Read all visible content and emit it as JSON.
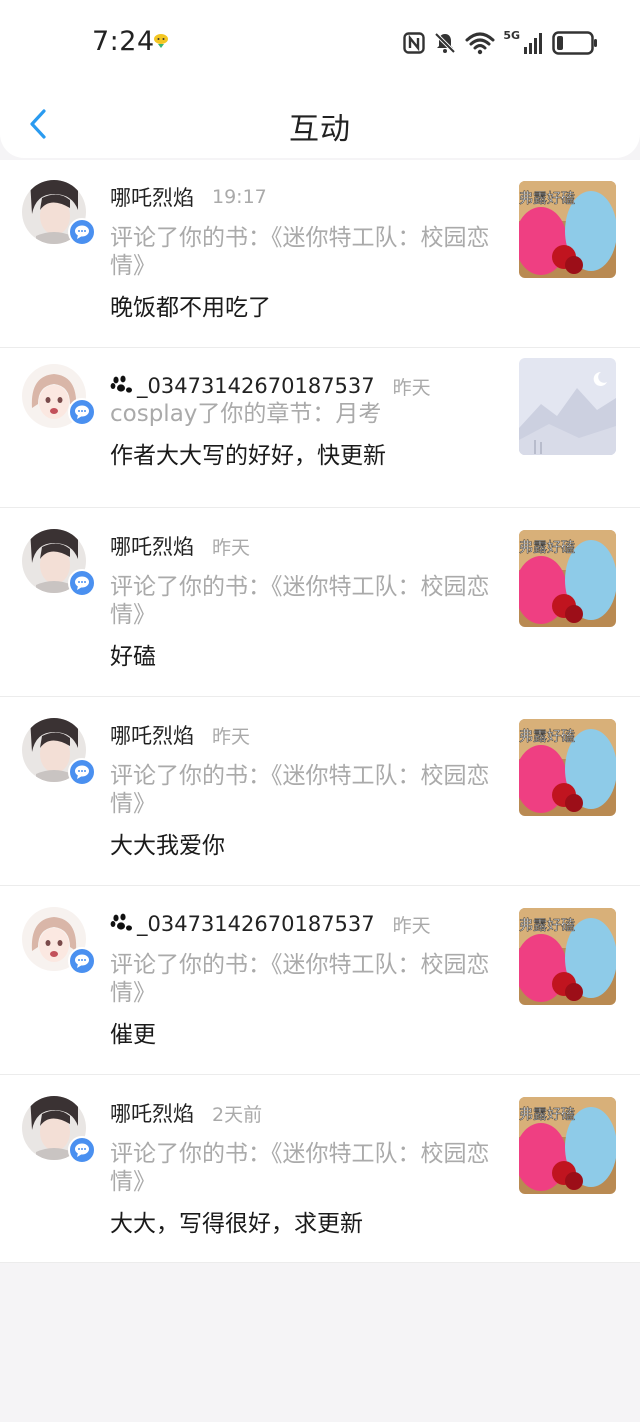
{
  "status": {
    "time": "7:24",
    "network_label": "5G"
  },
  "header": {
    "title": "互动"
  },
  "items": [
    {
      "user": "哪吒烈焰",
      "time": "19:17",
      "action": "评论了你的书：《迷你特工队：校园恋情》",
      "comment": "晚饭都不用吃了",
      "thumb_text": "弗露好磕"
    },
    {
      "user": "_03473142670187537",
      "time": "昨天",
      "action": "cosplay了你的章节：月考",
      "comment": "作者大大写的好好，快更新"
    },
    {
      "user": "哪吒烈焰",
      "time": "昨天",
      "action": "评论了你的书：《迷你特工队：校园恋情》",
      "comment": "好磕",
      "thumb_text": "弗露好磕"
    },
    {
      "user": "哪吒烈焰",
      "time": "昨天",
      "action": "评论了你的书：《迷你特工队：校园恋情》",
      "comment": "大大我爱你",
      "thumb_text": "弗露好磕"
    },
    {
      "user": "_03473142670187537",
      "time": "昨天",
      "action": "评论了你的书：《迷你特工队：校园恋情》",
      "comment": "催更",
      "thumb_text": "弗露好磕"
    },
    {
      "user": "哪吒烈焰",
      "time": "2天前",
      "action": "评论了你的书：《迷你特工队：校园恋情》",
      "comment": "大大，写得很好，求更新",
      "thumb_text": "弗露好磕"
    }
  ],
  "colors": {
    "accent": "#4a90f0",
    "back_arrow": "#2a9bf0",
    "muted_text": "#aaaaaa",
    "background": "#f5f4f6"
  }
}
